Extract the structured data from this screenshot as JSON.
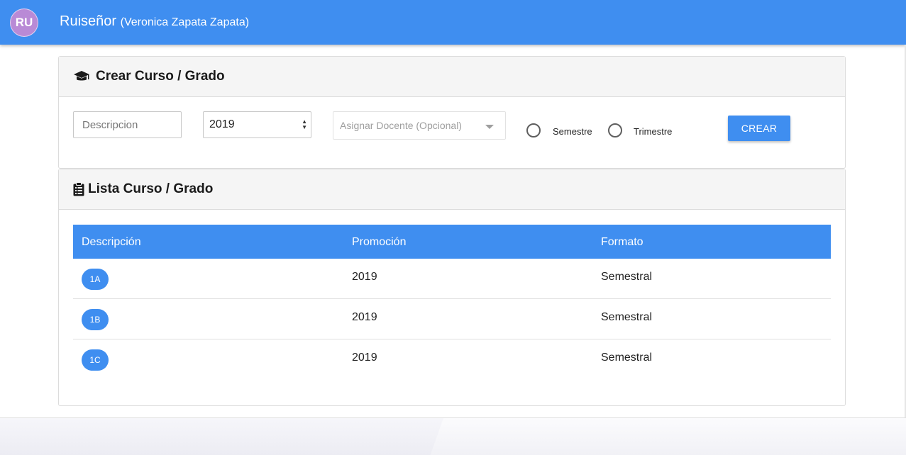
{
  "app": {
    "avatar_initials": "RU",
    "title": "Ruiseñor",
    "user": "(Veronica Zapata Zapata)",
    "brand_color": "#3f8ef0"
  },
  "create_card": {
    "icon": "graduation-cap-icon",
    "title": "Crear Curso / Grado",
    "description_placeholder": "Descripcion",
    "description_value": "",
    "year_selected": "2019",
    "teacher_placeholder": "Asignar Docente (Opcional)",
    "radio_semestre_label": "Semestre",
    "radio_trimestre_label": "Trimestre",
    "create_button_label": "CREAR"
  },
  "list_card": {
    "icon": "clipboard-list-icon",
    "title": "Lista Curso / Grado",
    "columns": [
      "Descripción",
      "Promoción",
      "Formato"
    ],
    "rows": [
      {
        "descripcion": "1A",
        "promocion": "2019",
        "formato": "Semestral"
      },
      {
        "descripcion": "1B",
        "promocion": "2019",
        "formato": "Semestral"
      },
      {
        "descripcion": "1C",
        "promocion": "2019",
        "formato": "Semestral"
      }
    ]
  }
}
